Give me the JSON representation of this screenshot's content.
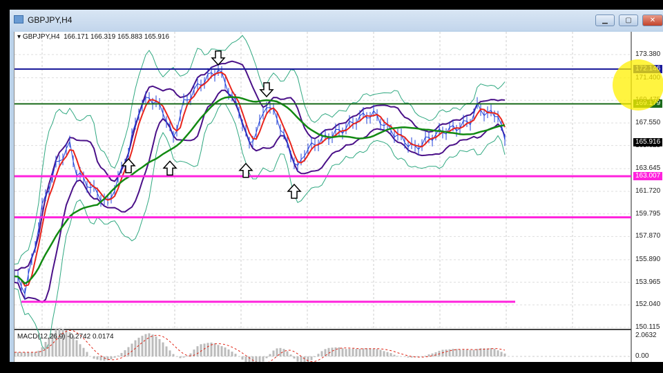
{
  "window": {
    "title": "GBPJPY,H4",
    "buttons": [
      "minimize",
      "maximize",
      "close"
    ]
  },
  "header": {
    "symbol": "GBPJPY,H4",
    "ohlc": "166.171 166.319 165.883 165.916"
  },
  "macd": {
    "label": "MACD(12,26,9)",
    "values": "-0.2742 0.0174",
    "ticks": [
      "2.0632",
      "0.00"
    ]
  },
  "colors": {
    "price": "#1f3fd8",
    "fast_ma": "#e8241c",
    "slow_ma": "#128a12",
    "inner_band": "#4a1088",
    "outer_band": "#2fa880",
    "hline_blue": "#1a1a9a",
    "hline_green": "#1a6a1a",
    "hline_magenta": "#ff22dd"
  },
  "chart_data": {
    "type": "line",
    "title": "GBPJPY,H4",
    "xlabel": "",
    "ylabel": "",
    "ylim": [
      150.115,
      173.38
    ],
    "y_ticks": [
      "173.380",
      "171.400",
      "169.475",
      "167.550",
      "165.625",
      "163.645",
      "161.720",
      "159.795",
      "157.870",
      "155.890",
      "153.965",
      "152.040",
      "150.115"
    ],
    "y_tick_values": [
      173.38,
      171.4,
      169.475,
      167.55,
      165.625,
      163.645,
      161.72,
      159.795,
      157.87,
      155.89,
      153.965,
      152.04,
      150.115
    ],
    "series": [
      {
        "name": "close",
        "points": [
          [
            0,
            154.47
          ],
          [
            3,
            153.29
          ],
          [
            5,
            155.65
          ],
          [
            8,
            160.36
          ],
          [
            12,
            163.9
          ],
          [
            16,
            165.66
          ],
          [
            18,
            163.31
          ],
          [
            22,
            162.13
          ],
          [
            27,
            160.66
          ],
          [
            30,
            162.72
          ],
          [
            33,
            165.08
          ],
          [
            36,
            168.61
          ],
          [
            39,
            169.79
          ],
          [
            43,
            168.61
          ],
          [
            46,
            166.25
          ],
          [
            49,
            169.2
          ],
          [
            54,
            170.97
          ],
          [
            59,
            172.14
          ],
          [
            62,
            170.38
          ],
          [
            65,
            168.61
          ],
          [
            68,
            165.66
          ],
          [
            71,
            167.43
          ],
          [
            73,
            169.2
          ],
          [
            76,
            168.02
          ],
          [
            79,
            165.66
          ],
          [
            82,
            163.6
          ],
          [
            84,
            165.08
          ],
          [
            88,
            165.96
          ],
          [
            92,
            166.55
          ],
          [
            96,
            167.14
          ],
          [
            100,
            168.02
          ],
          [
            104,
            168.32
          ],
          [
            108,
            167.14
          ],
          [
            112,
            166.25
          ],
          [
            116,
            165.37
          ],
          [
            120,
            166.25
          ],
          [
            124,
            166.84
          ],
          [
            128,
            167.14
          ],
          [
            132,
            167.73
          ],
          [
            134,
            168.9
          ],
          [
            137,
            168.32
          ],
          [
            140,
            168.32
          ],
          [
            142,
            165.92
          ]
        ]
      }
    ],
    "horizontal_lines": [
      {
        "price": 172.146,
        "label": "172.146",
        "color": "#1a1a9a"
      },
      {
        "price": 169.179,
        "label": "169.179",
        "color": "#1a6a1a"
      },
      {
        "price": 163.007,
        "label": "163.007",
        "color": "#ff22dd"
      },
      {
        "price": 159.5,
        "label": "",
        "color": "#ff22dd"
      },
      {
        "price": 152.3,
        "label": "",
        "color": "#ff22dd"
      }
    ],
    "current_price": {
      "price": 165.916,
      "label": "165.916"
    },
    "annotations": [
      {
        "bar": 59,
        "price": 173.09,
        "type": "down-arrow"
      },
      {
        "bar": 73,
        "price": 170.38,
        "type": "down-arrow"
      },
      {
        "bar": 33,
        "price": 163.9,
        "type": "up-arrow"
      },
      {
        "bar": 45,
        "price": 163.7,
        "type": "up-arrow"
      },
      {
        "bar": 67,
        "price": 163.5,
        "type": "up-arrow"
      },
      {
        "bar": 81,
        "price": 161.72,
        "type": "up-arrow"
      }
    ]
  }
}
